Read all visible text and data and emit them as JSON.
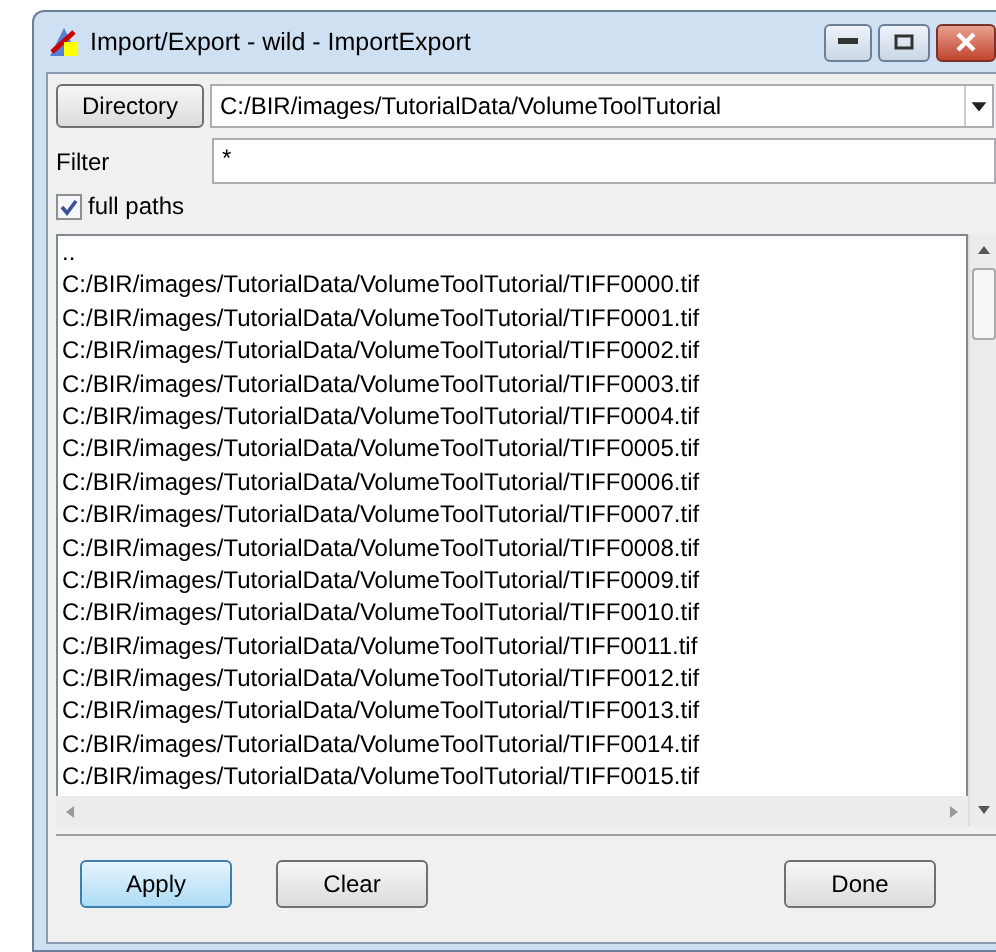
{
  "window": {
    "title": "Import/Export - wild - ImportExport"
  },
  "directory": {
    "button": "Directory",
    "value": "C:/BIR/images/TutorialData/VolumeToolTutorial"
  },
  "filter": {
    "label": "Filter",
    "value": "*"
  },
  "full_paths": {
    "label": "full paths",
    "checked": true
  },
  "files": [
    "..",
    "C:/BIR/images/TutorialData/VolumeToolTutorial/TIFF0000.tif",
    "C:/BIR/images/TutorialData/VolumeToolTutorial/TIFF0001.tif",
    "C:/BIR/images/TutorialData/VolumeToolTutorial/TIFF0002.tif",
    "C:/BIR/images/TutorialData/VolumeToolTutorial/TIFF0003.tif",
    "C:/BIR/images/TutorialData/VolumeToolTutorial/TIFF0004.tif",
    "C:/BIR/images/TutorialData/VolumeToolTutorial/TIFF0005.tif",
    "C:/BIR/images/TutorialData/VolumeToolTutorial/TIFF0006.tif",
    "C:/BIR/images/TutorialData/VolumeToolTutorial/TIFF0007.tif",
    "C:/BIR/images/TutorialData/VolumeToolTutorial/TIFF0008.tif",
    "C:/BIR/images/TutorialData/VolumeToolTutorial/TIFF0009.tif",
    "C:/BIR/images/TutorialData/VolumeToolTutorial/TIFF0010.tif",
    "C:/BIR/images/TutorialData/VolumeToolTutorial/TIFF0011.tif",
    "C:/BIR/images/TutorialData/VolumeToolTutorial/TIFF0012.tif",
    "C:/BIR/images/TutorialData/VolumeToolTutorial/TIFF0013.tif",
    "C:/BIR/images/TutorialData/VolumeToolTutorial/TIFF0014.tif",
    "C:/BIR/images/TutorialData/VolumeToolTutorial/TIFF0015.tif"
  ],
  "buttons": [
    {
      "label": "Apply",
      "kind": "focused"
    },
    {
      "label": "Clear",
      "kind": "normal"
    },
    {
      "label": "Done",
      "kind": "normal"
    }
  ]
}
